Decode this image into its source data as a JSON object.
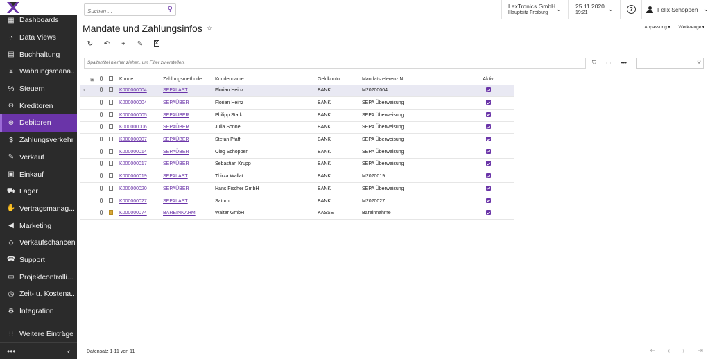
{
  "sidebar": {
    "items": [
      {
        "label": "Dashboards",
        "icon": "dashboard-icon",
        "glyph": "▦"
      },
      {
        "label": "Data Views",
        "icon": "pie-chart-icon",
        "glyph": "◔"
      },
      {
        "label": "Buchhaltung",
        "icon": "ledger-icon",
        "glyph": "▤"
      },
      {
        "label": "Währungsmana...",
        "icon": "currency-icon",
        "glyph": "¥"
      },
      {
        "label": "Steuern",
        "icon": "percent-icon",
        "glyph": "%"
      },
      {
        "label": "Kreditoren",
        "icon": "minus-circle-icon",
        "glyph": "⊖"
      },
      {
        "label": "Debitoren",
        "icon": "plus-circle-icon",
        "glyph": "⊕"
      },
      {
        "label": "Zahlungsverkehr",
        "icon": "dollar-icon",
        "glyph": "$"
      },
      {
        "label": "Verkauf",
        "icon": "edit-icon",
        "glyph": "✎"
      },
      {
        "label": "Einkauf",
        "icon": "cart-icon",
        "glyph": "▣"
      },
      {
        "label": "Lager",
        "icon": "truck-icon",
        "glyph": "⛟"
      },
      {
        "label": "Vertragsmanag...",
        "icon": "handshake-icon",
        "glyph": "✋"
      },
      {
        "label": "Marketing",
        "icon": "megaphone-icon",
        "glyph": "◀"
      },
      {
        "label": "Verkaufschancen",
        "icon": "tag-icon",
        "glyph": "◇"
      },
      {
        "label": "Support",
        "icon": "support-icon",
        "glyph": "☎"
      },
      {
        "label": "Projektcontrolli...",
        "icon": "briefcase-icon",
        "glyph": "▭"
      },
      {
        "label": "Zeit- u. Kostena...",
        "icon": "clock-icon",
        "glyph": "◷"
      },
      {
        "label": "Integration",
        "icon": "integration-icon",
        "glyph": "⚙"
      }
    ],
    "more_label": "Weitere Einträge",
    "active_index": 6
  },
  "topbar": {
    "search_placeholder": "Suchen ...",
    "company": "LexTronics GmbH",
    "branch": "Hauptsitz Freiburg",
    "date": "25.11.2020",
    "time": "19:21",
    "user": "Felix Schoppen"
  },
  "page": {
    "title": "Mandate und Zahlungsinfos",
    "menu_customize": "Anpassung",
    "menu_tools": "Werkzeuge",
    "group_hint": "Spaltentitel hierher ziehen, um Filter zu erstellen."
  },
  "table": {
    "columns": [
      "Kunde",
      "Zahlungsmethode",
      "Kundenname",
      "Geldkonto",
      "Mandatsreferenz Nr.",
      "Aktiv"
    ],
    "rows": [
      {
        "kunde": "K000000004",
        "methode": "SEPALAST",
        "name": "Florian Heinz",
        "konto": "BANK",
        "ref": "M20200004",
        "aktiv": true,
        "doc": "empty"
      },
      {
        "kunde": "K000000004",
        "methode": "SEPAÜBER",
        "name": "Florian Heinz",
        "konto": "BANK",
        "ref": "SEPA Überweisung",
        "aktiv": true,
        "doc": "empty"
      },
      {
        "kunde": "K000000005",
        "methode": "SEPAÜBER",
        "name": "Philipp Stark",
        "konto": "BANK",
        "ref": "SEPA Überweisung",
        "aktiv": true,
        "doc": "empty"
      },
      {
        "kunde": "K000000006",
        "methode": "SEPAÜBER",
        "name": "Julia Sonne",
        "konto": "BANK",
        "ref": "SEPA Überweisung",
        "aktiv": true,
        "doc": "empty"
      },
      {
        "kunde": "K000000007",
        "methode": "SEPAÜBER",
        "name": "Stefan Pfaff",
        "konto": "BANK",
        "ref": "SEPA Überweisung",
        "aktiv": true,
        "doc": "empty"
      },
      {
        "kunde": "K000000014",
        "methode": "SEPAÜBER",
        "name": "Oleg Schoppen",
        "konto": "BANK",
        "ref": "SEPA Überweisung",
        "aktiv": true,
        "doc": "empty"
      },
      {
        "kunde": "K000000017",
        "methode": "SEPAÜBER",
        "name": "Sebastian Krupp",
        "konto": "BANK",
        "ref": "SEPA Überweisung",
        "aktiv": true,
        "doc": "empty"
      },
      {
        "kunde": "K000000019",
        "methode": "SEPALAST",
        "name": "Thirza Wallat",
        "konto": "BANK",
        "ref": "M2020019",
        "aktiv": true,
        "doc": "empty"
      },
      {
        "kunde": "K000000020",
        "methode": "SEPAÜBER",
        "name": "Hans Fischer GmbH",
        "konto": "BANK",
        "ref": "SEPA Überweisung",
        "aktiv": true,
        "doc": "empty"
      },
      {
        "kunde": "K000000027",
        "methode": "SEPALAST",
        "name": "Saturn",
        "konto": "BANK",
        "ref": "M2020027",
        "aktiv": true,
        "doc": "empty"
      },
      {
        "kunde": "K000000074",
        "methode": "BAREINNAHM",
        "name": "Walter GmbH",
        "konto": "KASSE",
        "ref": "Bareinnahme",
        "aktiv": true,
        "doc": "filled"
      }
    ]
  },
  "footer": {
    "record_info": "Datensatz 1-11 von 11"
  },
  "colors": {
    "accent": "#6a34a8",
    "sidebar_bg": "#2b2b2b"
  }
}
